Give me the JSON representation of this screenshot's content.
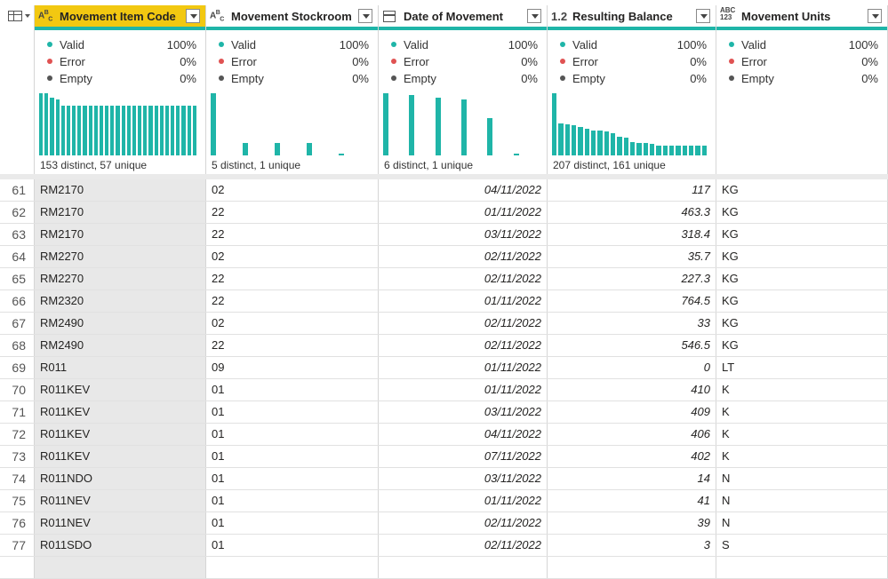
{
  "columns": [
    {
      "type_icon": "ABC",
      "name": "Movement Item Code",
      "selected": true,
      "valid": "100%",
      "error": "0%",
      "empty": "0%",
      "distinct": "153 distinct, 57 unique",
      "histogram": [
        1.0,
        1.0,
        0.93,
        0.9,
        0.8,
        0.8,
        0.8,
        0.8,
        0.8,
        0.8,
        0.8,
        0.8,
        0.8,
        0.8,
        0.8,
        0.8,
        0.8,
        0.8,
        0.8,
        0.8,
        0.8,
        0.8,
        0.8,
        0.8,
        0.8,
        0.8,
        0.8,
        0.8,
        0.8
      ]
    },
    {
      "type_icon": "ABC",
      "name": "Movement Stockroom",
      "selected": false,
      "valid": "100%",
      "error": "0%",
      "empty": "0%",
      "distinct": "5 distinct, 1 unique",
      "histogram": [
        1.0,
        0.2,
        0.2,
        0.2,
        0.03
      ]
    },
    {
      "type_icon": "calendar",
      "name": "Date of Movement",
      "selected": false,
      "valid": "100%",
      "error": "0%",
      "empty": "0%",
      "distinct": "6 distinct, 1 unique",
      "histogram": [
        1.0,
        0.97,
        0.93,
        0.9,
        0.6,
        0.03
      ]
    },
    {
      "type_icon": "1.2",
      "name": "Resulting Balance",
      "selected": false,
      "valid": "100%",
      "error": "0%",
      "empty": "0%",
      "distinct": "207 distinct, 161 unique",
      "histogram": [
        1.0,
        0.52,
        0.5,
        0.48,
        0.45,
        0.43,
        0.4,
        0.4,
        0.38,
        0.35,
        0.3,
        0.28,
        0.22,
        0.2,
        0.2,
        0.18,
        0.16,
        0.16,
        0.16,
        0.16,
        0.16,
        0.16,
        0.16,
        0.16
      ]
    },
    {
      "type_icon": "ABC123",
      "name": "Movement Units",
      "selected": false,
      "valid": "100%",
      "error": "0%",
      "empty": "0%",
      "distinct": "",
      "histogram": []
    }
  ],
  "labels": {
    "valid": "Valid",
    "error": "Error",
    "empty": "Empty"
  },
  "colors": {
    "accent": "#1fb5a8",
    "selected_header": "#f2c811",
    "error_dot": "#e05252",
    "empty_dot": "#555555"
  },
  "rows": [
    {
      "n": "61",
      "code": "RM2170",
      "stock": "02",
      "date": "04/11/2022",
      "bal": "117",
      "unit": "KG"
    },
    {
      "n": "62",
      "code": "RM2170",
      "stock": "22",
      "date": "01/11/2022",
      "bal": "463.3",
      "unit": "KG"
    },
    {
      "n": "63",
      "code": "RM2170",
      "stock": "22",
      "date": "03/11/2022",
      "bal": "318.4",
      "unit": "KG"
    },
    {
      "n": "64",
      "code": "RM2270",
      "stock": "02",
      "date": "02/11/2022",
      "bal": "35.7",
      "unit": "KG"
    },
    {
      "n": "65",
      "code": "RM2270",
      "stock": "22",
      "date": "02/11/2022",
      "bal": "227.3",
      "unit": "KG"
    },
    {
      "n": "66",
      "code": "RM2320",
      "stock": "22",
      "date": "01/11/2022",
      "bal": "764.5",
      "unit": "KG"
    },
    {
      "n": "67",
      "code": "RM2490",
      "stock": "02",
      "date": "02/11/2022",
      "bal": "33",
      "unit": "KG"
    },
    {
      "n": "68",
      "code": "RM2490",
      "stock": "22",
      "date": "02/11/2022",
      "bal": "546.5",
      "unit": "KG"
    },
    {
      "n": "69",
      "code": "R011",
      "stock": "09",
      "date": "01/11/2022",
      "bal": "0",
      "unit": "LT"
    },
    {
      "n": "70",
      "code": "R011KEV",
      "stock": "01",
      "date": "01/11/2022",
      "bal": "410",
      "unit": "K"
    },
    {
      "n": "71",
      "code": "R011KEV",
      "stock": "01",
      "date": "03/11/2022",
      "bal": "409",
      "unit": "K"
    },
    {
      "n": "72",
      "code": "R011KEV",
      "stock": "01",
      "date": "04/11/2022",
      "bal": "406",
      "unit": "K"
    },
    {
      "n": "73",
      "code": "R011KEV",
      "stock": "01",
      "date": "07/11/2022",
      "bal": "402",
      "unit": "K"
    },
    {
      "n": "74",
      "code": "R011NDO",
      "stock": "01",
      "date": "03/11/2022",
      "bal": "14",
      "unit": "N"
    },
    {
      "n": "75",
      "code": "R011NEV",
      "stock": "01",
      "date": "01/11/2022",
      "bal": "41",
      "unit": "N"
    },
    {
      "n": "76",
      "code": "R011NEV",
      "stock": "01",
      "date": "02/11/2022",
      "bal": "39",
      "unit": "N"
    },
    {
      "n": "77",
      "code": "R011SDO",
      "stock": "01",
      "date": "02/11/2022",
      "bal": "3",
      "unit": "S"
    }
  ]
}
